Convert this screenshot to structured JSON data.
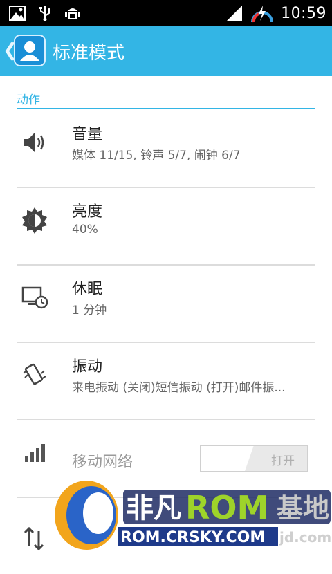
{
  "statusbar": {
    "time": "10:59"
  },
  "actionbar": {
    "back": "❮",
    "title": "标准模式"
  },
  "section": {
    "title": "动作"
  },
  "items": [
    {
      "title": "音量",
      "summary": "媒体 11/15, 铃声 5/7, 闹钟 6/7"
    },
    {
      "title": "亮度",
      "summary": "40%"
    },
    {
      "title": "休眠",
      "summary": "1 分钟"
    },
    {
      "title": "振动",
      "summary": "来电振动 (关闭)短信振动 (打开)邮件振..."
    },
    {
      "title": "移动网络",
      "toggle_label": "打开"
    }
  ],
  "watermark": {
    "brand1": "非凡",
    "brand2": "ROM",
    "brand3": "基地",
    "url": "ROM.CRSKY.COM",
    "url2": "jd.com"
  }
}
